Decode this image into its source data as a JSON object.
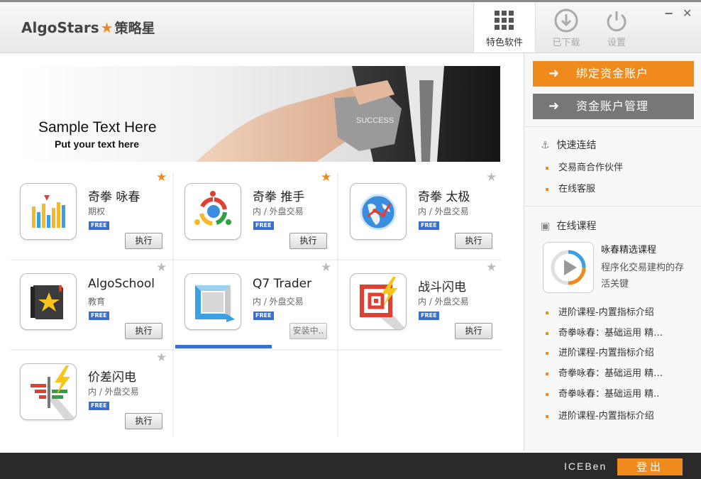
{
  "app": {
    "logo_text": "AlgoStars",
    "logo_cn": "策略星"
  },
  "nav": {
    "featured": "特色软件",
    "downloaded": "已下载",
    "settings": "设置"
  },
  "window": {
    "minimize": "−",
    "close": "✕"
  },
  "banner": {
    "title": "Sample Text Here",
    "subtitle": "Put your text here",
    "badge": "SUCCESS"
  },
  "apps": [
    {
      "name": "奇拳 咏春",
      "type": "期权",
      "badge": "FREE",
      "button": "执行",
      "starred": true
    },
    {
      "name": "奇拳 推手",
      "type": "内 / 外盘交易",
      "badge": "FREE",
      "button": "执行",
      "starred": true
    },
    {
      "name": "奇拳 太极",
      "type": "内 / 外盘交易",
      "badge": "FREE",
      "button": "执行",
      "starred": false
    },
    {
      "name": "AlgoSchool",
      "type": "教育",
      "badge": "FREE",
      "button": "执行",
      "starred": false
    },
    {
      "name": "Q7 Trader",
      "type": "内 / 外盘交易",
      "badge": "FREE",
      "button": "安装中..",
      "starred": false,
      "install_progress": 0.6
    },
    {
      "name": "战斗闪电",
      "type": "内 / 外盘交易",
      "badge": "FREE",
      "button": "执行",
      "starred": false
    },
    {
      "name": "价差闪电",
      "type": "内 / 外盘交易",
      "badge": "FREE",
      "button": "执行",
      "starred": false
    }
  ],
  "sidebar": {
    "bind_account": "绑定资金账户",
    "manage_account": "资金账户管理",
    "quick_links_title": "快速连结",
    "quick_links": [
      "交易商合作伙伴",
      "在线客服"
    ],
    "courses_title": "在线课程",
    "featured_course": {
      "title": "咏春精选课程",
      "desc": "程序化交易建构的存活关键"
    },
    "course_links": [
      "进阶课程-内置指标介绍",
      "奇拳咏春：基础运用 精…",
      "进阶课程-内置指标介绍",
      "奇拳咏春：基础运用 精…",
      "奇拳咏春：基础运用 精..",
      "进阶课程-内置指标介绍"
    ]
  },
  "footer": {
    "username": "ICEBen",
    "logout": "登出"
  },
  "colors": {
    "accent": "#f08a1c",
    "secondary_button": "#777777",
    "free_badge": "#3a6fd0",
    "footer": "#2a2a2a"
  }
}
